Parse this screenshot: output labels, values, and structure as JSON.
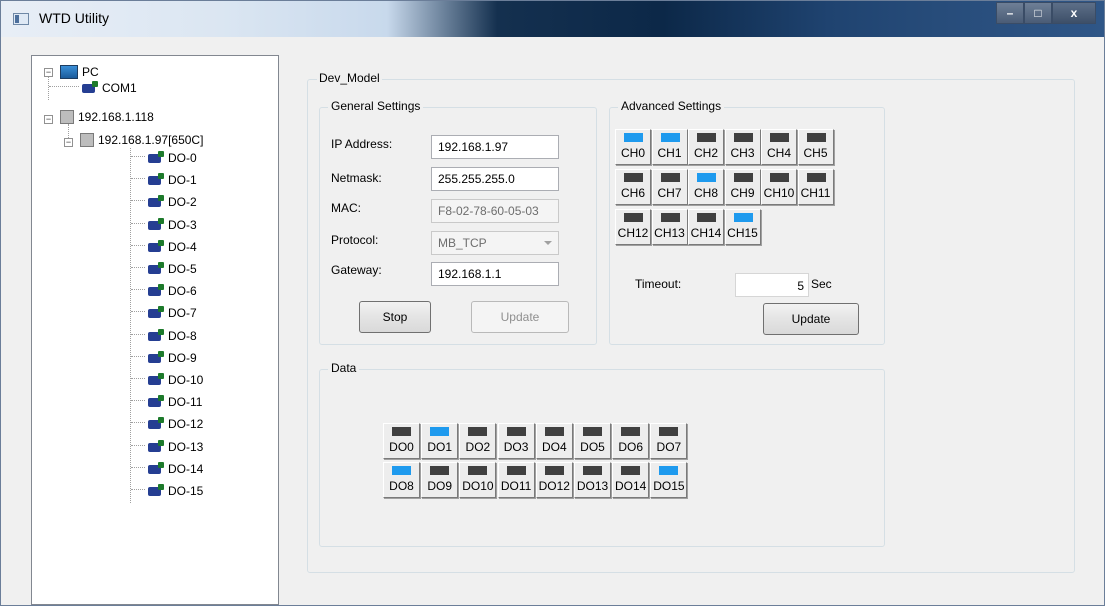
{
  "window": {
    "title": "WTD Utility",
    "minimize": "–",
    "maximize": "□",
    "close": "x"
  },
  "tree": {
    "root": "PC",
    "com": "COM1",
    "host": "192.168.1.118",
    "device": "192.168.1.97[650C]",
    "channels": [
      "DO-0",
      "DO-1",
      "DO-2",
      "DO-3",
      "DO-4",
      "DO-5",
      "DO-6",
      "DO-7",
      "DO-8",
      "DO-9",
      "DO-10",
      "DO-11",
      "DO-12",
      "DO-13",
      "DO-14",
      "DO-15"
    ]
  },
  "dev_model": {
    "title": "Dev_Model"
  },
  "general": {
    "title": "General Settings",
    "ip_label": "IP Address:",
    "ip_value": "192.168.1.97",
    "netmask_label": "Netmask:",
    "netmask_value": "255.255.255.0",
    "mac_label": "MAC:",
    "mac_value": "F8-02-78-60-05-03",
    "protocol_label": "Protocol:",
    "protocol_value": "MB_TCP",
    "gateway_label": "Gateway:",
    "gateway_value": "192.168.1.1",
    "stop_label": "Stop",
    "update_label": "Update"
  },
  "advanced": {
    "title": "Advanced Settings",
    "channels": [
      {
        "label": "CH0",
        "on": true
      },
      {
        "label": "CH1",
        "on": true
      },
      {
        "label": "CH2",
        "on": false
      },
      {
        "label": "CH3",
        "on": false
      },
      {
        "label": "CH4",
        "on": false
      },
      {
        "label": "CH5",
        "on": false
      },
      {
        "label": "CH6",
        "on": false
      },
      {
        "label": "CH7",
        "on": false
      },
      {
        "label": "CH8",
        "on": true
      },
      {
        "label": "CH9",
        "on": false
      },
      {
        "label": "CH10",
        "on": false
      },
      {
        "label": "CH11",
        "on": false
      },
      {
        "label": "CH12",
        "on": false
      },
      {
        "label": "CH13",
        "on": false
      },
      {
        "label": "CH14",
        "on": false
      },
      {
        "label": "CH15",
        "on": true
      }
    ],
    "timeout_label": "Timeout:",
    "timeout_value": "5",
    "timeout_unit": "Sec",
    "update_label": "Update"
  },
  "data": {
    "title": "Data",
    "outputs": [
      {
        "label": "DO0",
        "on": false
      },
      {
        "label": "DO1",
        "on": true
      },
      {
        "label": "DO2",
        "on": false
      },
      {
        "label": "DO3",
        "on": false
      },
      {
        "label": "DO4",
        "on": false
      },
      {
        "label": "DO5",
        "on": false
      },
      {
        "label": "DO6",
        "on": false
      },
      {
        "label": "DO7",
        "on": false
      },
      {
        "label": "DO8",
        "on": true
      },
      {
        "label": "DO9",
        "on": false
      },
      {
        "label": "DO10",
        "on": false
      },
      {
        "label": "DO11",
        "on": false
      },
      {
        "label": "DO12",
        "on": false
      },
      {
        "label": "DO13",
        "on": false
      },
      {
        "label": "DO14",
        "on": false
      },
      {
        "label": "DO15",
        "on": true
      }
    ]
  },
  "colors": {
    "led_on": "#1e9aee",
    "led_off": "#404040"
  }
}
